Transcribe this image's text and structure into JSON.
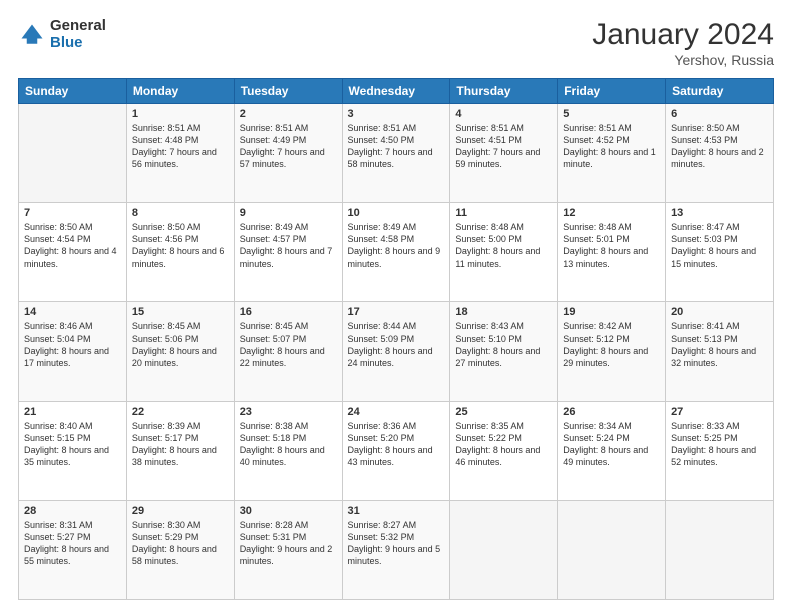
{
  "header": {
    "logo_general": "General",
    "logo_blue": "Blue",
    "month_year": "January 2024",
    "location": "Yershov, Russia"
  },
  "days_of_week": [
    "Sunday",
    "Monday",
    "Tuesday",
    "Wednesday",
    "Thursday",
    "Friday",
    "Saturday"
  ],
  "weeks": [
    [
      {
        "day": "",
        "empty": true
      },
      {
        "day": "1",
        "sunrise": "Sunrise: 8:51 AM",
        "sunset": "Sunset: 4:48 PM",
        "daylight": "Daylight: 7 hours and 56 minutes."
      },
      {
        "day": "2",
        "sunrise": "Sunrise: 8:51 AM",
        "sunset": "Sunset: 4:49 PM",
        "daylight": "Daylight: 7 hours and 57 minutes."
      },
      {
        "day": "3",
        "sunrise": "Sunrise: 8:51 AM",
        "sunset": "Sunset: 4:50 PM",
        "daylight": "Daylight: 7 hours and 58 minutes."
      },
      {
        "day": "4",
        "sunrise": "Sunrise: 8:51 AM",
        "sunset": "Sunset: 4:51 PM",
        "daylight": "Daylight: 7 hours and 59 minutes."
      },
      {
        "day": "5",
        "sunrise": "Sunrise: 8:51 AM",
        "sunset": "Sunset: 4:52 PM",
        "daylight": "Daylight: 8 hours and 1 minute."
      },
      {
        "day": "6",
        "sunrise": "Sunrise: 8:50 AM",
        "sunset": "Sunset: 4:53 PM",
        "daylight": "Daylight: 8 hours and 2 minutes."
      }
    ],
    [
      {
        "day": "7",
        "sunrise": "Sunrise: 8:50 AM",
        "sunset": "Sunset: 4:54 PM",
        "daylight": "Daylight: 8 hours and 4 minutes."
      },
      {
        "day": "8",
        "sunrise": "Sunrise: 8:50 AM",
        "sunset": "Sunset: 4:56 PM",
        "daylight": "Daylight: 8 hours and 6 minutes."
      },
      {
        "day": "9",
        "sunrise": "Sunrise: 8:49 AM",
        "sunset": "Sunset: 4:57 PM",
        "daylight": "Daylight: 8 hours and 7 minutes."
      },
      {
        "day": "10",
        "sunrise": "Sunrise: 8:49 AM",
        "sunset": "Sunset: 4:58 PM",
        "daylight": "Daylight: 8 hours and 9 minutes."
      },
      {
        "day": "11",
        "sunrise": "Sunrise: 8:48 AM",
        "sunset": "Sunset: 5:00 PM",
        "daylight": "Daylight: 8 hours and 11 minutes."
      },
      {
        "day": "12",
        "sunrise": "Sunrise: 8:48 AM",
        "sunset": "Sunset: 5:01 PM",
        "daylight": "Daylight: 8 hours and 13 minutes."
      },
      {
        "day": "13",
        "sunrise": "Sunrise: 8:47 AM",
        "sunset": "Sunset: 5:03 PM",
        "daylight": "Daylight: 8 hours and 15 minutes."
      }
    ],
    [
      {
        "day": "14",
        "sunrise": "Sunrise: 8:46 AM",
        "sunset": "Sunset: 5:04 PM",
        "daylight": "Daylight: 8 hours and 17 minutes."
      },
      {
        "day": "15",
        "sunrise": "Sunrise: 8:45 AM",
        "sunset": "Sunset: 5:06 PM",
        "daylight": "Daylight: 8 hours and 20 minutes."
      },
      {
        "day": "16",
        "sunrise": "Sunrise: 8:45 AM",
        "sunset": "Sunset: 5:07 PM",
        "daylight": "Daylight: 8 hours and 22 minutes."
      },
      {
        "day": "17",
        "sunrise": "Sunrise: 8:44 AM",
        "sunset": "Sunset: 5:09 PM",
        "daylight": "Daylight: 8 hours and 24 minutes."
      },
      {
        "day": "18",
        "sunrise": "Sunrise: 8:43 AM",
        "sunset": "Sunset: 5:10 PM",
        "daylight": "Daylight: 8 hours and 27 minutes."
      },
      {
        "day": "19",
        "sunrise": "Sunrise: 8:42 AM",
        "sunset": "Sunset: 5:12 PM",
        "daylight": "Daylight: 8 hours and 29 minutes."
      },
      {
        "day": "20",
        "sunrise": "Sunrise: 8:41 AM",
        "sunset": "Sunset: 5:13 PM",
        "daylight": "Daylight: 8 hours and 32 minutes."
      }
    ],
    [
      {
        "day": "21",
        "sunrise": "Sunrise: 8:40 AM",
        "sunset": "Sunset: 5:15 PM",
        "daylight": "Daylight: 8 hours and 35 minutes."
      },
      {
        "day": "22",
        "sunrise": "Sunrise: 8:39 AM",
        "sunset": "Sunset: 5:17 PM",
        "daylight": "Daylight: 8 hours and 38 minutes."
      },
      {
        "day": "23",
        "sunrise": "Sunrise: 8:38 AM",
        "sunset": "Sunset: 5:18 PM",
        "daylight": "Daylight: 8 hours and 40 minutes."
      },
      {
        "day": "24",
        "sunrise": "Sunrise: 8:36 AM",
        "sunset": "Sunset: 5:20 PM",
        "daylight": "Daylight: 8 hours and 43 minutes."
      },
      {
        "day": "25",
        "sunrise": "Sunrise: 8:35 AM",
        "sunset": "Sunset: 5:22 PM",
        "daylight": "Daylight: 8 hours and 46 minutes."
      },
      {
        "day": "26",
        "sunrise": "Sunrise: 8:34 AM",
        "sunset": "Sunset: 5:24 PM",
        "daylight": "Daylight: 8 hours and 49 minutes."
      },
      {
        "day": "27",
        "sunrise": "Sunrise: 8:33 AM",
        "sunset": "Sunset: 5:25 PM",
        "daylight": "Daylight: 8 hours and 52 minutes."
      }
    ],
    [
      {
        "day": "28",
        "sunrise": "Sunrise: 8:31 AM",
        "sunset": "Sunset: 5:27 PM",
        "daylight": "Daylight: 8 hours and 55 minutes."
      },
      {
        "day": "29",
        "sunrise": "Sunrise: 8:30 AM",
        "sunset": "Sunset: 5:29 PM",
        "daylight": "Daylight: 8 hours and 58 minutes."
      },
      {
        "day": "30",
        "sunrise": "Sunrise: 8:28 AM",
        "sunset": "Sunset: 5:31 PM",
        "daylight": "Daylight: 9 hours and 2 minutes."
      },
      {
        "day": "31",
        "sunrise": "Sunrise: 8:27 AM",
        "sunset": "Sunset: 5:32 PM",
        "daylight": "Daylight: 9 hours and 5 minutes."
      },
      {
        "day": "",
        "empty": true
      },
      {
        "day": "",
        "empty": true
      },
      {
        "day": "",
        "empty": true
      }
    ]
  ]
}
